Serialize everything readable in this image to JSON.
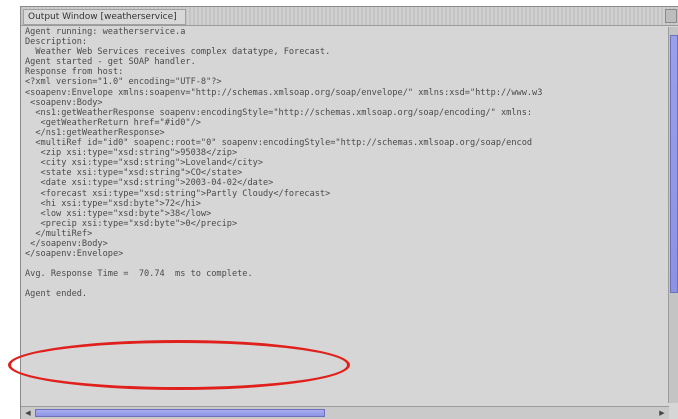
{
  "window": {
    "title": "Output Window [weatherservice]"
  },
  "output": {
    "lines": [
      "Agent running: weatherservice.a",
      "Description:",
      "  Weather Web Services receives complex datatype, Forecast.",
      "Agent started - get SOAP handler.",
      "Response from host:",
      "<?xml version=\"1.0\" encoding=\"UTF-8\"?>",
      "<soapenv:Envelope xmlns:soapenv=\"http://schemas.xmlsoap.org/soap/envelope/\" xmlns:xsd=\"http://www.w3",
      " <soapenv:Body>",
      "  <ns1:getWeatherResponse soapenv:encodingStyle=\"http://schemas.xmlsoap.org/soap/encoding/\" xmlns:",
      "   <getWeatherReturn href=\"#id0\"/>",
      "  </ns1:getWeatherResponse>",
      "  <multiRef id=\"id0\" soapenc:root=\"0\" soapenv:encodingStyle=\"http://schemas.xmlsoap.org/soap/encod",
      "   <zip xsi:type=\"xsd:string\">95038</zip>",
      "   <city xsi:type=\"xsd:string\">Loveland</city>",
      "   <state xsi:type=\"xsd:string\">CO</state>",
      "   <date xsi:type=\"xsd:string\">2003-04-02</date>",
      "   <forecast xsi:type=\"xsd:string\">Partly Cloudy</forecast>",
      "   <hi xsi:type=\"xsd:byte\">72</hi>",
      "   <low xsi:type=\"xsd:byte\">38</low>",
      "   <precip xsi:type=\"xsd:byte\">0</precip>",
      "  </multiRef>",
      " </soapenv:Body>",
      "</soapenv:Envelope>",
      "",
      "Avg. Response Time =  70.74  ms to complete.",
      "",
      "Agent ended."
    ]
  },
  "annotation": {
    "color": "#e0201c",
    "shape": "ellipse"
  }
}
